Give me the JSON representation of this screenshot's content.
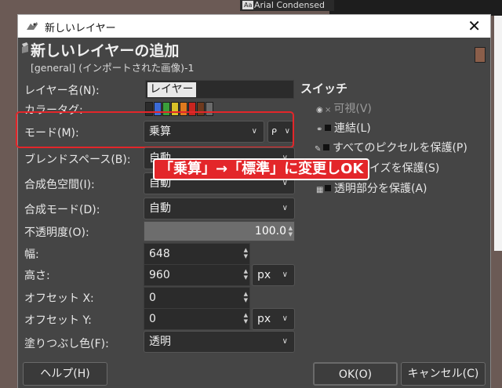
{
  "background": {
    "font_item": "Arial Condensed",
    "font_item_badge": "Aa"
  },
  "window": {
    "title": "新しいレイヤー",
    "close": "✕"
  },
  "header": {
    "title": "新しいレイヤーの追加",
    "subtitle": "[general] (インポートされた画像)-1"
  },
  "form": {
    "layer_name_label": "レイヤー名(N):",
    "layer_name_value": "レイヤー",
    "color_tag_label": "カラータグ:",
    "color_tags": [
      "#2b2b2b",
      "#3b6bd6",
      "#3a9e3a",
      "#d8c128",
      "#e07a1e",
      "#c8251f",
      "#6e3a1e",
      "#6a6a6a"
    ],
    "mode_label": "モード(M):",
    "mode_value": "乗算",
    "mode_extra": "ᑭ",
    "blend_space_label": "ブレンドスペース(B):",
    "blend_space_value": "自動",
    "composite_space_label": "合成色空間(I):",
    "composite_space_value": "自動",
    "composite_mode_label": "合成モード(D):",
    "composite_mode_value": "自動",
    "opacity_label": "不透明度(O):",
    "opacity_value": "100.0",
    "width_label": "幅:",
    "width_value": "648",
    "height_label": "高さ:",
    "height_value": "960",
    "unit_value": "px",
    "offset_x_label": "オフセット X:",
    "offset_x_value": "0",
    "offset_y_label": "オフセット Y:",
    "offset_y_value": "0",
    "offset_unit_value": "px",
    "fill_label": "塗りつぶし色(F):",
    "fill_value": "透明"
  },
  "switches": {
    "title": "スイッチ",
    "visible": "可視(V)",
    "linked": "連結(L)",
    "lock_pixels": "すべてのピクセルを保護(P)",
    "lock_position": "イズを保護(S)",
    "lock_alpha": "透明部分を保護(A)"
  },
  "annotation": "「乗算」→「標準」に変更しOK",
  "buttons": {
    "help": "ヘルプ(H)",
    "ok": "OK(O)",
    "cancel": "キャンセル(C)"
  }
}
